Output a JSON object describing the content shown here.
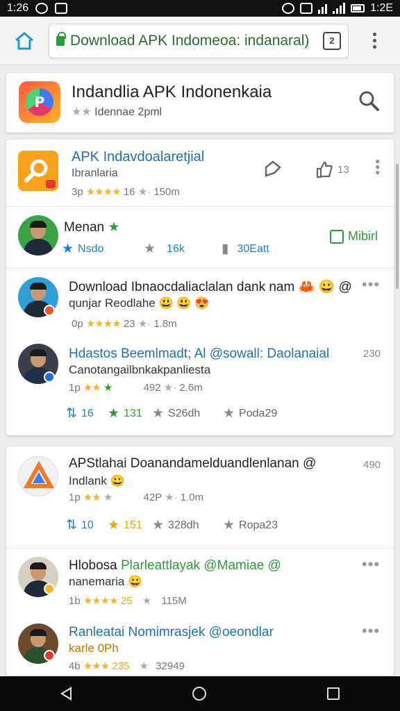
{
  "status_bar": {
    "time_left": "1:26",
    "time_right": "1:2E"
  },
  "browser": {
    "url": "Download APK Indomeoa: indanaral)",
    "tab_count": "2"
  },
  "header": {
    "title": "Indandlia APK Indonenkaia",
    "subtitle": "Idennae 2pml"
  },
  "app_row": {
    "title": "APK Indavdoalaretjial",
    "subtitle": "Ibranlaria",
    "meta_prefix": "3p",
    "meta_stars": "★★★★",
    "meta_rating": "16",
    "meta_size": "150m",
    "like_count": "13"
  },
  "profile_row": {
    "name": "Menan",
    "follow_label": "Mibirl",
    "stats": [
      {
        "icon": "star-icon",
        "value": "Nsdo"
      },
      {
        "icon": "star-icon",
        "value": "16k"
      },
      {
        "icon": "bookmark-icon",
        "value": "30Eatt"
      }
    ]
  },
  "posts_card_1": [
    {
      "line1": "Download Ibnaocdaliaclalan dank nam 🦀 😀 @",
      "line2": "qunjar Reodlahe 😃 😃 😍",
      "meta_prefix": "0p",
      "meta_stars": "★★★★",
      "meta_rating": "23",
      "meta_size": "1.8m",
      "time": ""
    },
    {
      "line1": "Hdastos Beemlmadt; Al @sowall: Daolanaial",
      "line2": "Canotangailbnkakpanliesta",
      "meta_prefix": "1p",
      "meta_stars": "★★",
      "meta_rating": "492",
      "meta_size": "2.6m",
      "time": "230",
      "actions": [
        {
          "icon": "repost-icon",
          "value": "16"
        },
        {
          "icon": "star-icon",
          "value": "131"
        },
        {
          "icon": "star-icon",
          "value": "S26dh"
        },
        {
          "icon": "star-icon",
          "value": "Poda29"
        }
      ]
    }
  ],
  "posts_card_2": [
    {
      "line1": "APStlahai Doanandamelduandlenlanan @",
      "line2": "Indlank 😀",
      "meta_prefix": "1p",
      "meta_stars": "★★",
      "meta_rating": "42P",
      "meta_size": "1.0m",
      "time": "490",
      "actions": [
        {
          "icon": "repost-icon",
          "value": "10"
        },
        {
          "icon": "star-icon",
          "value": "151"
        },
        {
          "icon": "star-icon",
          "value": "328dh"
        },
        {
          "icon": "star-icon",
          "value": "Ropa23"
        }
      ]
    },
    {
      "line1_a": "Hlobosa",
      "line1_b": "Plarleattlayak @Mamiae @",
      "line2": "nanemaria 😀",
      "meta_prefix": "1b",
      "meta_stars": "★★★★",
      "meta_rating": "25",
      "meta_size": "115M"
    },
    {
      "line1": "Ranleatai Nomimrasjek @oeondlar",
      "line2": "karle 0Ph",
      "meta_prefix": "4b",
      "meta_stars": "★★★",
      "meta_rating": "235",
      "meta_size": "32949"
    }
  ],
  "colors": {
    "accent": "#1a9ad6",
    "link": "#1f6fb8",
    "green": "#2e9b3a",
    "star": "#f0b729"
  }
}
